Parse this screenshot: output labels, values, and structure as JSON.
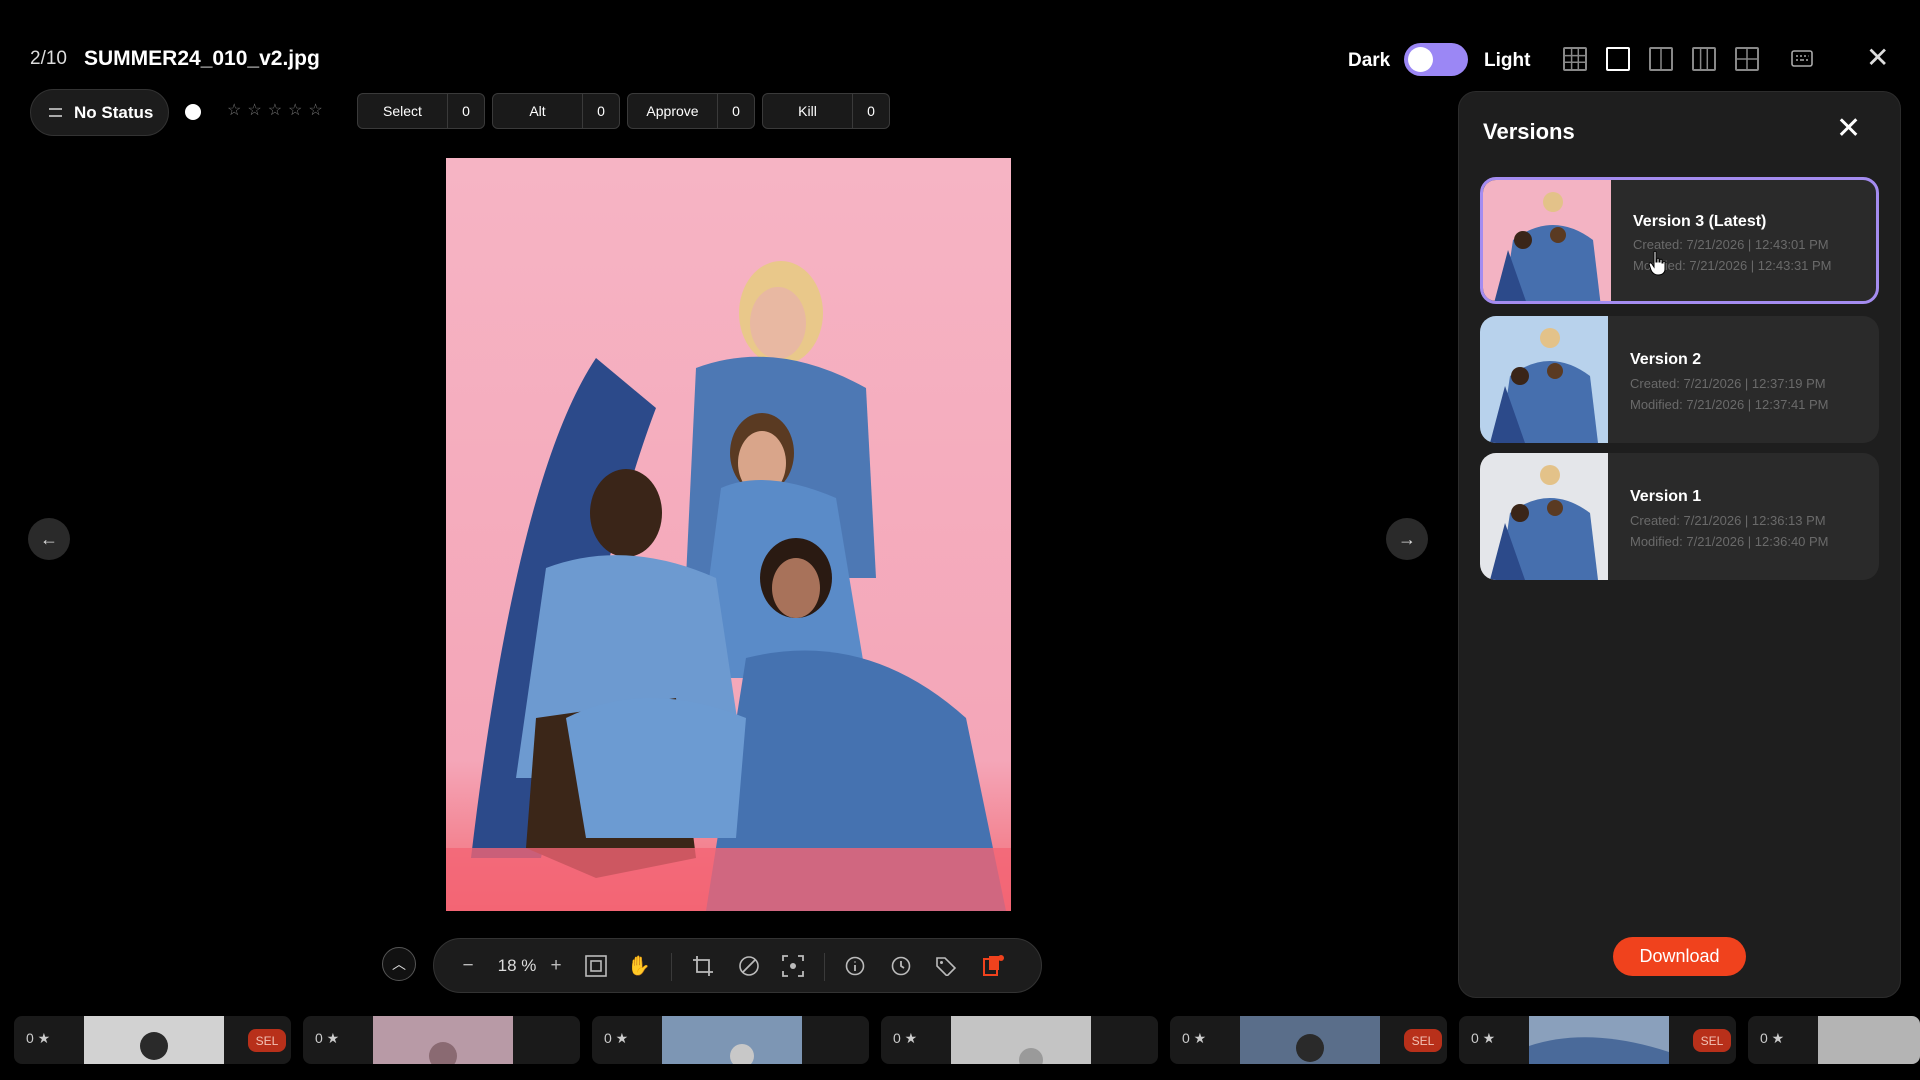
{
  "header": {
    "counter": "2/10",
    "filename": "SUMMER24_010_v2.jpg",
    "theme_dark": "Dark",
    "theme_light": "Light"
  },
  "status": {
    "label": "No Status",
    "rating_stars": 0,
    "buttons": [
      {
        "label": "Select",
        "count": "0"
      },
      {
        "label": "Alt",
        "count": "0"
      },
      {
        "label": "Approve",
        "count": "0"
      },
      {
        "label": "Kill",
        "count": "0"
      }
    ]
  },
  "toolbar": {
    "zoom_minus": "−",
    "zoom": "18 %",
    "zoom_plus": "+"
  },
  "versions": {
    "title": "Versions",
    "items": [
      {
        "name": "Version 3 (Latest)",
        "created": "Created: 7/21/2026 | 12:43:01 PM",
        "modified": "Modified: 7/21/2026 | 12:43:31 PM",
        "active": true
      },
      {
        "name": "Version 2",
        "created": "Created: 7/21/2026 | 12:37:19 PM",
        "modified": "Modified: 7/21/2026 | 12:37:41 PM",
        "active": false
      },
      {
        "name": "Version 1",
        "created": "Created: 7/21/2026 | 12:36:13 PM",
        "modified": "Modified: 7/21/2026 | 12:36:40 PM",
        "active": false
      }
    ],
    "download_label": "Download"
  },
  "filmstrip": [
    {
      "rating": "0",
      "sel": "SEL"
    },
    {
      "rating": "0",
      "sel": ""
    },
    {
      "rating": "0",
      "sel": ""
    },
    {
      "rating": "0",
      "sel": ""
    },
    {
      "rating": "0",
      "sel": "SEL"
    },
    {
      "rating": "0",
      "sel": "SEL"
    },
    {
      "rating": "0",
      "sel": ""
    }
  ],
  "colors": {
    "accent": "#9b87f5",
    "download": "#f0421d",
    "sel_badge": "#b8301a",
    "photo_background": "#f7b5c4"
  }
}
